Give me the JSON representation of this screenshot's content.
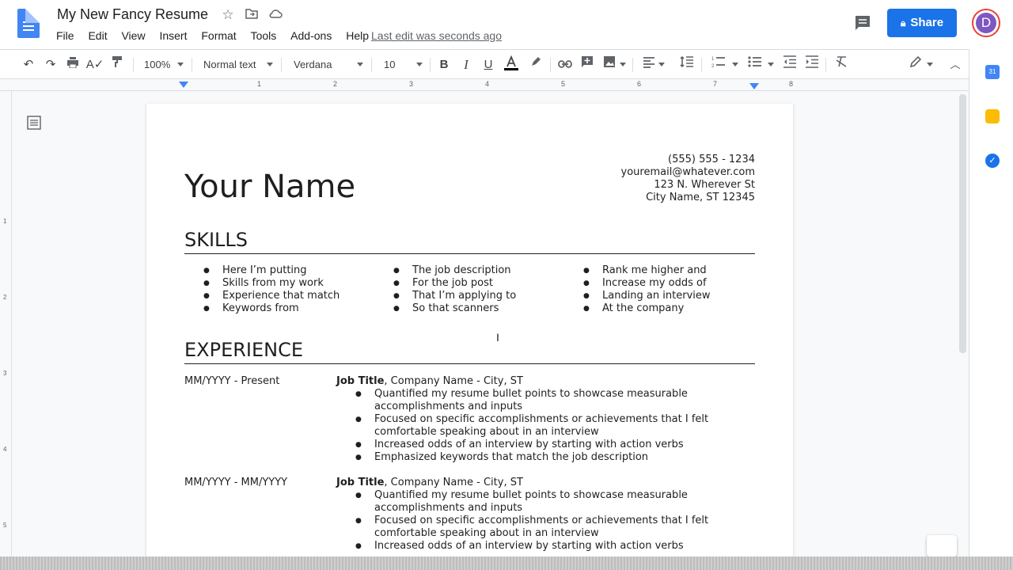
{
  "header": {
    "title": "My New Fancy Resume",
    "menu": [
      "File",
      "Edit",
      "View",
      "Insert",
      "Format",
      "Tools",
      "Add-ons",
      "Help"
    ],
    "last_edit": "Last edit was seconds ago",
    "share_label": "Share",
    "avatar_letter": "D"
  },
  "toolbar": {
    "zoom": "100%",
    "style": "Normal text",
    "font": "Verdana",
    "font_size": "10",
    "bold": "B",
    "italic": "I",
    "underline": "U"
  },
  "ruler": {
    "top_numbers": [
      "1",
      "2",
      "3",
      "4",
      "5",
      "6",
      "7",
      "8"
    ],
    "left_numbers": [
      "1",
      "2",
      "3",
      "4",
      "5"
    ]
  },
  "document": {
    "name": "Your Name",
    "contact": [
      "(555) 555 - 1234",
      "youremail@whatever.com",
      "123 N. Wherever St",
      "City Name, ST 12345"
    ],
    "skills_title": "SKILLS",
    "skills_columns": [
      [
        "Here I’m putting",
        "Skills from my work",
        "Experience that match",
        "Keywords from"
      ],
      [
        "The job description",
        "For the job post",
        "That I’m applying to",
        "So that scanners"
      ],
      [
        "Rank me higher and",
        "Increase my odds of",
        "Landing an interview",
        "At the company"
      ]
    ],
    "experience_title": "EXPERIENCE",
    "experience": [
      {
        "dates": "MM/YYYY - Present",
        "job_title": "Job Title",
        "company": ", Company Name - City, ST",
        "bullets": [
          "Quantified my resume bullet points to showcase measurable accomplishments and inputs",
          "Focused on specific accomplishments or achievements that I felt comfortable speaking about in an interview",
          "Increased odds of an interview by starting with action verbs",
          "Emphasized keywords that match the job description"
        ]
      },
      {
        "dates": "MM/YYYY - MM/YYYY",
        "job_title": "Job Title",
        "company": ", Company Name - City, ST",
        "bullets": [
          "Quantified my resume bullet points to showcase measurable accomplishments and inputs",
          "Focused on specific accomplishments or achievements that I felt comfortable speaking about in an interview",
          "Increased odds of an interview by starting with action verbs"
        ]
      }
    ]
  },
  "colors": {
    "accent": "#1a73e8",
    "avatar_bg": "#7e57c2",
    "doc_icon": "#4285f4"
  }
}
